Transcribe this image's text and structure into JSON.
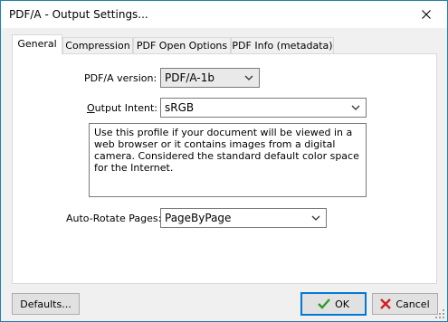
{
  "window": {
    "title": "PDF/A - Output Settings..."
  },
  "tabs": [
    {
      "label": "General",
      "active": true
    },
    {
      "label": "Compression",
      "active": false
    },
    {
      "label": "PDF Open Options",
      "active": false
    },
    {
      "label": "PDF Info (metadata)",
      "active": false
    }
  ],
  "general": {
    "pdfa_version_label": "PDF/A version:",
    "pdfa_version_value": "PDF/A-1b",
    "output_intent_label_accel": "O",
    "output_intent_label_rest": "utput Intent:",
    "output_intent_value": "sRGB",
    "output_intent_description": "Use this profile if your document will be viewed in a web browser or it contains images from a digital camera. Considered the standard default color space for the Internet.",
    "auto_rotate_label": "Auto-Rotate Pages:",
    "auto_rotate_value": "PageByPage"
  },
  "buttons": {
    "defaults": "Defaults...",
    "ok": "OK",
    "cancel": "Cancel"
  },
  "icons": {
    "ok": "checkmark-icon",
    "cancel": "red-x-icon",
    "close": "close-icon",
    "dropdown": "chevron-down-icon"
  },
  "colors": {
    "ok_icon": "#2e9a2e",
    "cancel_icon": "#d42020",
    "default_button_border": "#0078d7"
  }
}
